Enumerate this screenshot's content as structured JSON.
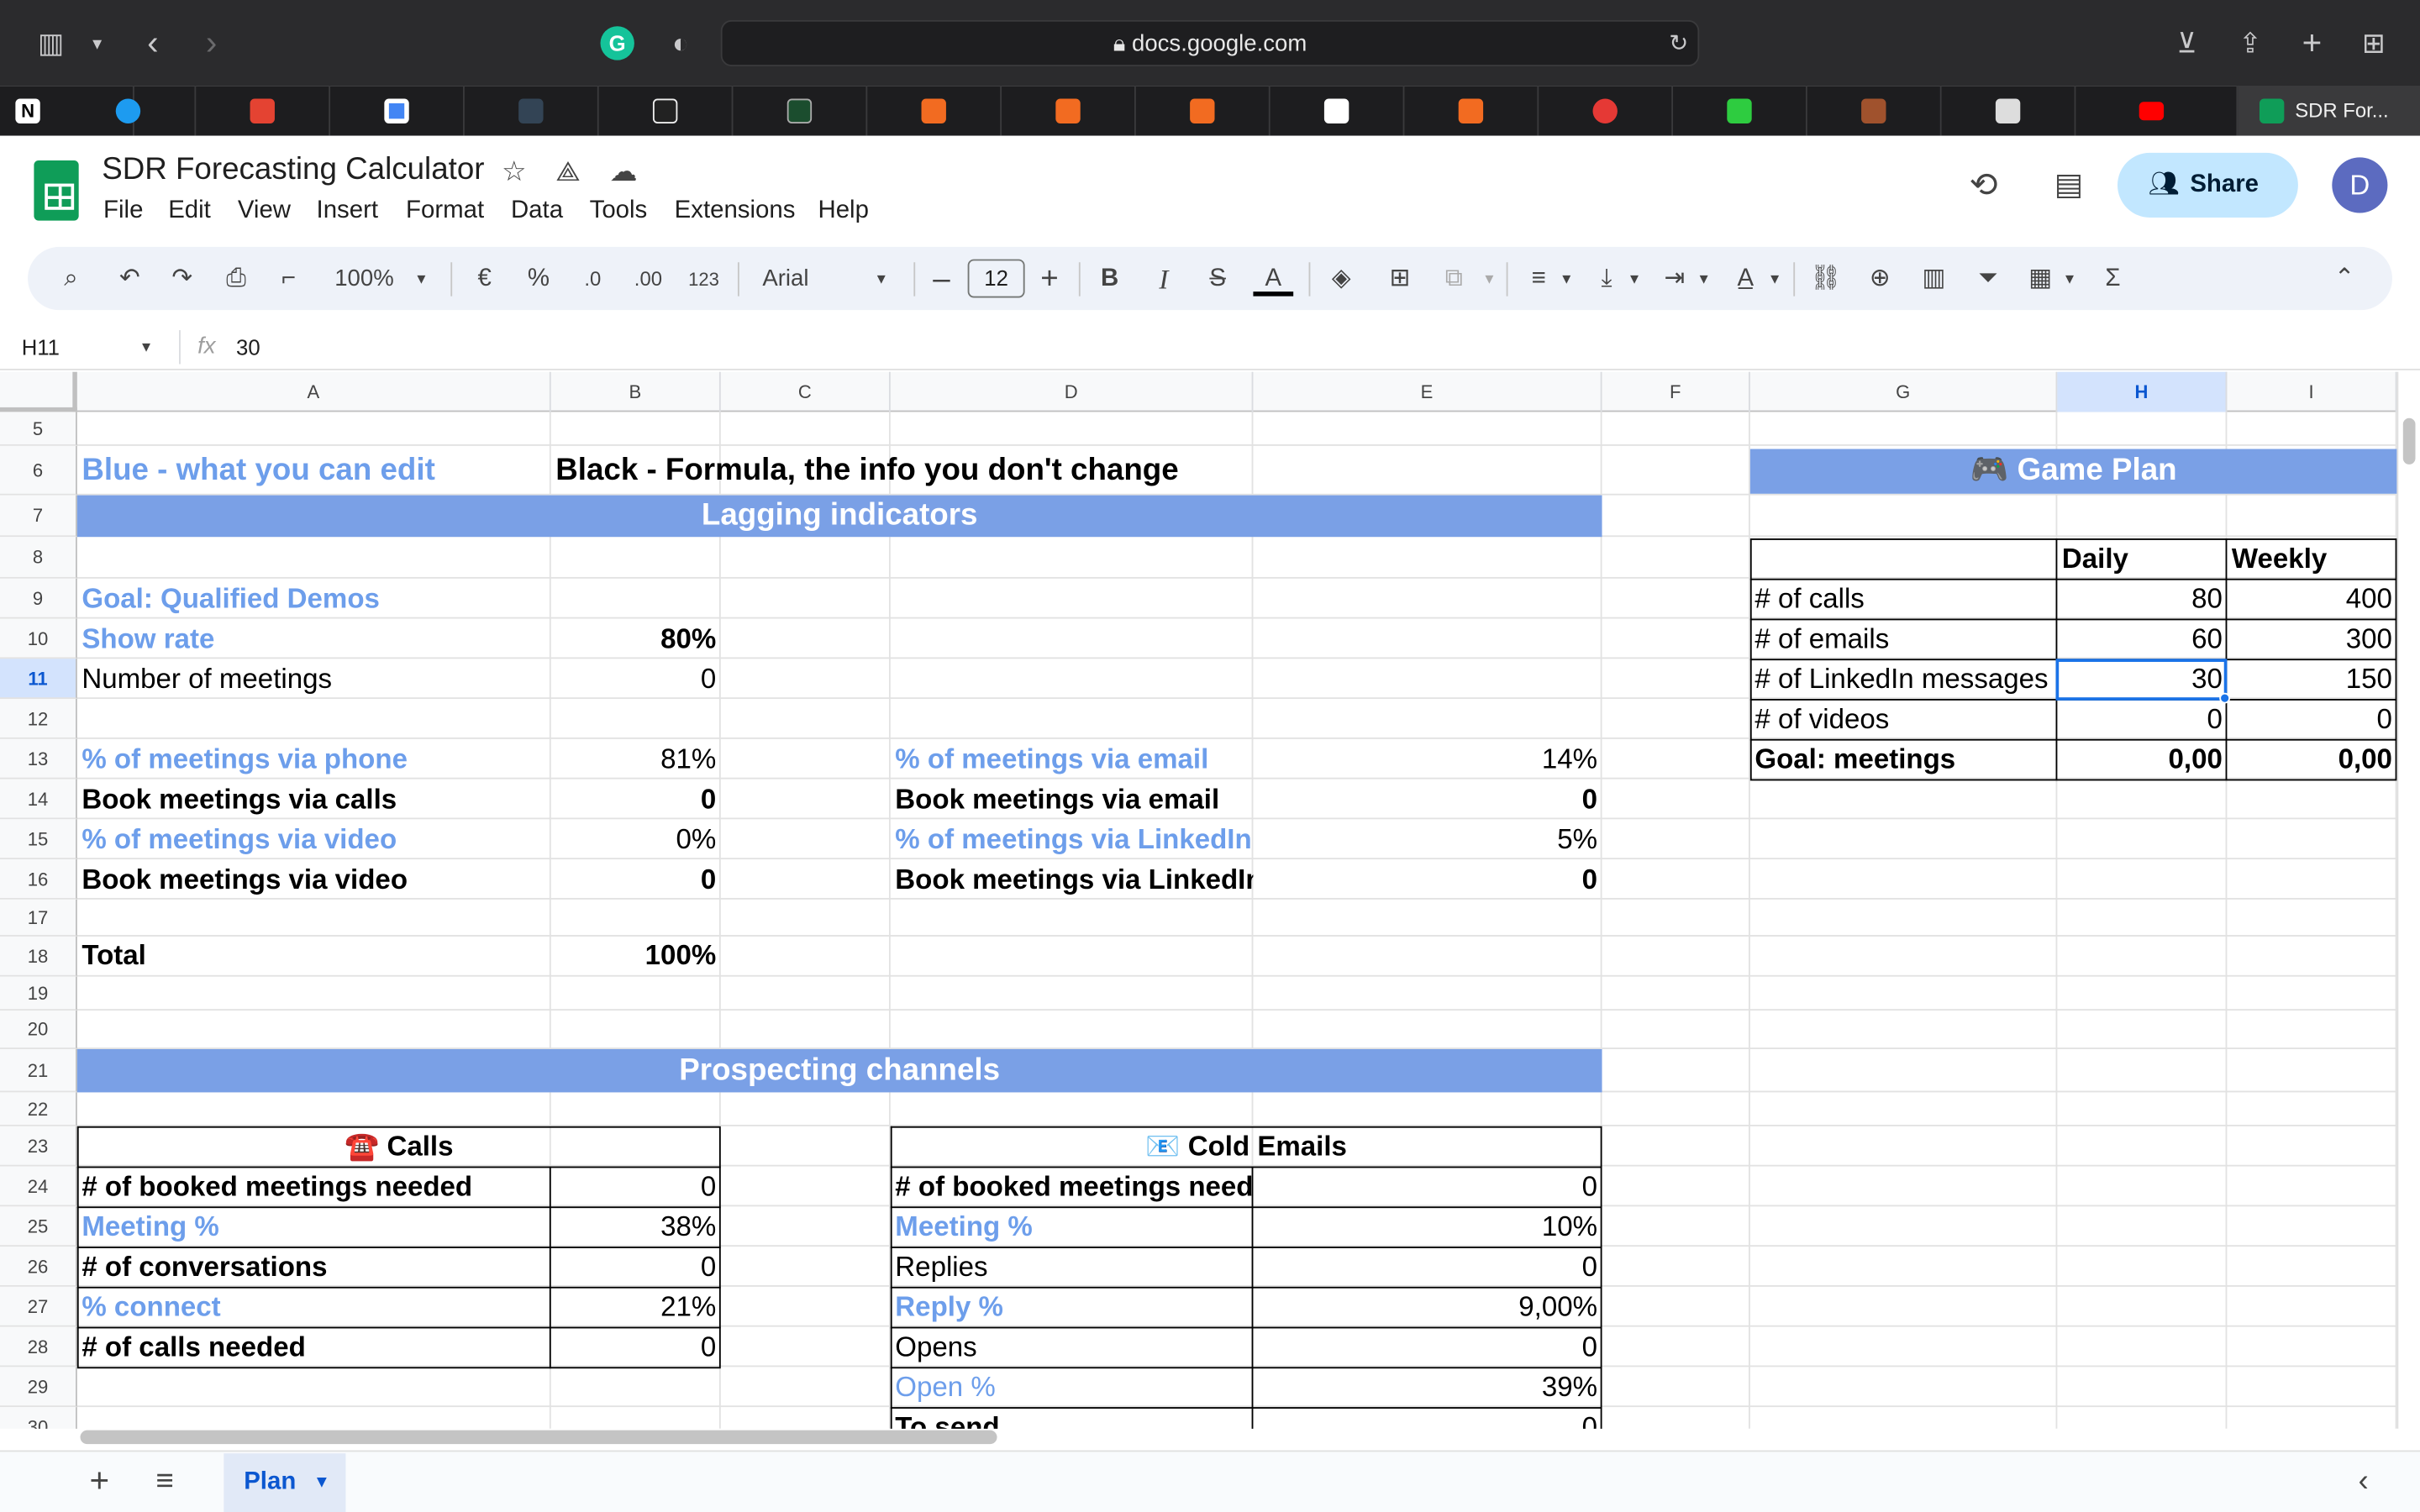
{
  "browser": {
    "url": "docs.google.com",
    "active_tab_title": "SDR For...",
    "tab_favicons": [
      "notion-icon",
      "twitter-icon",
      "todoist-icon",
      "google-calendar-icon",
      "profile-photo-icon",
      "notes-icon",
      "app-icon",
      "bookmark-icon",
      "bookmark-icon",
      "bookmark-icon",
      "bull-icon",
      "bookmark-icon",
      "poker-icon",
      "home-icon",
      "photo-icon",
      "app-icon",
      "youtube-icon"
    ]
  },
  "doc": {
    "title": "SDR Forecasting Calculator",
    "menu": [
      "File",
      "Edit",
      "View",
      "Insert",
      "Format",
      "Data",
      "Tools",
      "Extensions",
      "Help"
    ],
    "share_label": "Share",
    "avatar_letter": "D"
  },
  "toolbar": {
    "zoom": "100%",
    "currency": "€",
    "percent": "%",
    "dec_decrease": ".0",
    "dec_increase": ".00",
    "number_format": "123",
    "font": "Arial",
    "font_size": "12"
  },
  "formula_bar": {
    "cell_ref": "H11",
    "fx": "fx",
    "value": "30"
  },
  "grid": {
    "columns": [
      "A",
      "B",
      "C",
      "D",
      "E",
      "F",
      "G",
      "H",
      "I"
    ],
    "selected_column": "H",
    "rows": [
      "5",
      "6",
      "7",
      "8",
      "9",
      "10",
      "11",
      "12",
      "13",
      "14",
      "15",
      "16",
      "17",
      "18",
      "19",
      "20",
      "21",
      "22",
      "23",
      "24",
      "25",
      "26",
      "27",
      "28",
      "29",
      "30"
    ],
    "selected_row": "11"
  },
  "cells": {
    "a6": "Blue - what you can edit",
    "b6": "Black - Formula, the info you don't change",
    "lagging": "Lagging indicators",
    "game_plan": "🎮 Game Plan",
    "h8": "Daily",
    "i8": "Weekly",
    "a9": "Goal: Qualified Demos",
    "g9": "# of calls",
    "h9": "80",
    "i9": "400",
    "a10": "Show rate",
    "b10": "80%",
    "g10": "# of emails",
    "h10": "60",
    "i10": "300",
    "a11": "Number of meetings",
    "b11": "0",
    "g11": "# of LinkedIn messages",
    "h11": "30",
    "i11": "150",
    "g12": "# of videos",
    "h12": "0",
    "i12": "0",
    "a13": "% of meetings via phone",
    "b13": "81%",
    "d13": "% of meetings via email",
    "e13": "14%",
    "g13": "Goal: meetings",
    "h13": "0,00",
    "i13": "0,00",
    "a14": "Book meetings via calls",
    "b14": "0",
    "d14": "Book meetings via email",
    "e14": "0",
    "a15": "% of meetings via video",
    "b15": "0%",
    "d15": "% of meetings via LinkedIn",
    "e15": "5%",
    "a16": "Book meetings via video",
    "b16": "0",
    "d16": "Book meetings via LinkedIn",
    "e16": "0",
    "a18": "Total",
    "b18": "100%",
    "prospecting": "Prospecting channels",
    "calls": "☎️ Calls",
    "cold_emails": "📧 Cold Emails",
    "a24": "# of booked meetings needed",
    "b24": "0",
    "d24": "# of booked meetings needed",
    "e24": "0",
    "a25": "Meeting %",
    "b25": "38%",
    "d25": "Meeting %",
    "e25": "10%",
    "a26": "# of conversations",
    "b26": "0",
    "d26": "Replies",
    "e26": "0",
    "a27": "% connect",
    "b27": "21%",
    "d27": "Reply %",
    "e27": "9,00%",
    "a28": "# of calls needed",
    "b28": "0",
    "d28": "Opens",
    "e28": "0",
    "d29": "Open %",
    "e29": "39%",
    "d30": "To send",
    "e30": "0"
  },
  "sheets": {
    "active": "Plan"
  }
}
